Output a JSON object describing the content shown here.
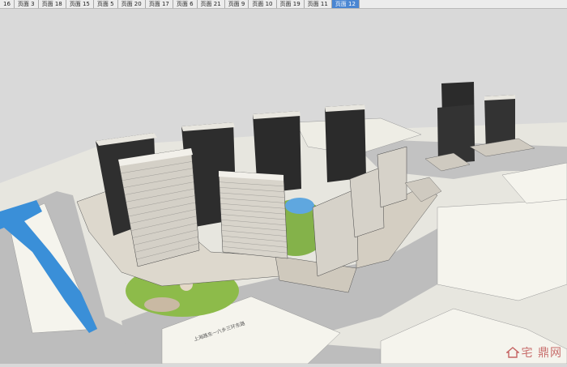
{
  "tabs": [
    {
      "label": "16"
    },
    {
      "label": "页面 3"
    },
    {
      "label": "页面 18"
    },
    {
      "label": "页面 15"
    },
    {
      "label": "页面 5"
    },
    {
      "label": "页面 20"
    },
    {
      "label": "页面 17"
    },
    {
      "label": "页面 6"
    },
    {
      "label": "页面 21"
    },
    {
      "label": "页面 9"
    },
    {
      "label": "页面 10"
    },
    {
      "label": "页面 19"
    },
    {
      "label": "页面 11"
    },
    {
      "label": "页面 12",
      "active": true
    }
  ],
  "scene": {
    "road_label": "上海路东一六乡三环东路",
    "colors": {
      "sky": "#d9d9d9",
      "ground": "#f2f1ea",
      "road": "#b9b9b9",
      "water": "#3a8fd8",
      "grass": "#8dbb4a",
      "tower_dark": "#2b2b2b",
      "tower_light": "#dcd8cf"
    }
  },
  "watermark": {
    "text": "宅 鼎网"
  }
}
